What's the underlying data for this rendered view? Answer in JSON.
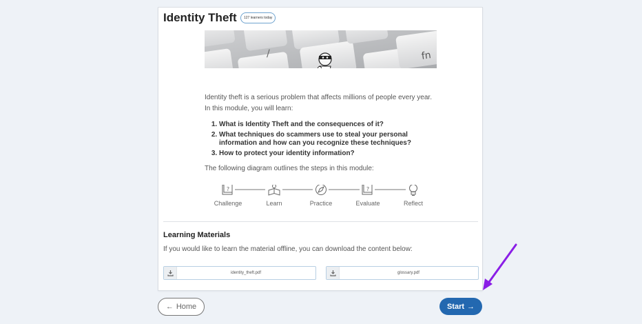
{
  "module": {
    "title": "Identity Theft",
    "learners_badge": "127 learners today",
    "intro_line1": "Identity theft is a serious problem that affects millions of people every year.",
    "intro_line2": "In this module, you will learn:",
    "goals": [
      "What is Identity Theft and the consequences of it?",
      "What techniques do scammers use to steal your personal information and how can you recognize these techniques?",
      "How to protect your identity information?"
    ],
    "diagram_caption": "The following diagram outlines the steps in this module:",
    "steps": [
      {
        "label": "Challenge",
        "icon": "question-book-icon"
      },
      {
        "label": "Learn",
        "icon": "open-book-person-icon"
      },
      {
        "label": "Practice",
        "icon": "compass-icon"
      },
      {
        "label": "Evaluate",
        "icon": "question-book-icon"
      },
      {
        "label": "Reflect",
        "icon": "lightbulb-icon"
      }
    ]
  },
  "materials": {
    "title": "Learning Materials",
    "description": "If you would like to learn the material offline, you can download the content below:",
    "files": [
      "identity_theft.pdf",
      "glossary.pdf"
    ],
    "download_icon": "download-icon"
  },
  "nav": {
    "home_label": "Home",
    "start_label": "Start"
  },
  "colors": {
    "primary": "#2368b0",
    "annotation_arrow": "#8a1ee6",
    "badge_border": "#6fa3cf"
  }
}
